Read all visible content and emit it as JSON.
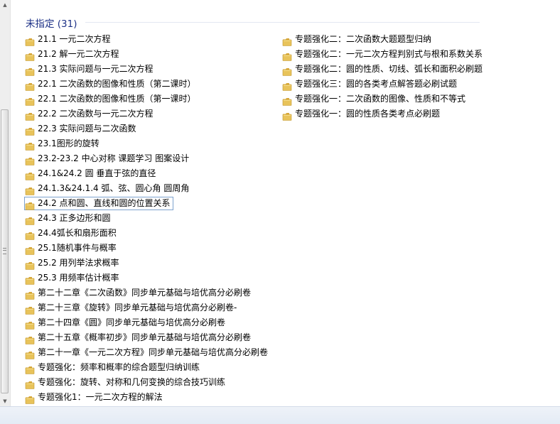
{
  "group": {
    "title": "未指定 (31)"
  },
  "colors": {
    "group_title": "#1e3287",
    "folder_body": "#e8c35a",
    "folder_tab": "#d9a93a",
    "selection_border": "#7da2ce"
  },
  "icons": {
    "folder": "folder-icon"
  },
  "items_left": [
    {
      "label": "21.1 一元二次方程"
    },
    {
      "label": "21.2 解一元二次方程"
    },
    {
      "label": "21.3 实际问题与一元二次方程"
    },
    {
      "label": "22.1 二次函数的图像和性质（第二课时）"
    },
    {
      "label": "22.1 二次函数的图像和性质（第一课时）"
    },
    {
      "label": "22.2 二次函数与一元二次方程"
    },
    {
      "label": "22.3 实际问题与二次函数"
    },
    {
      "label": "23.1图形的旋转"
    },
    {
      "label": "23.2-23.2 中心对称 课题学习 图案设计"
    },
    {
      "label": "24.1&24.2 圆 垂直于弦的直径"
    },
    {
      "label": "24.1.3&24.1.4 弧、弦、圆心角 圆周角"
    },
    {
      "label": "24.2 点和圆、直线和圆的位置关系",
      "selected": true
    },
    {
      "label": "24.3 正多边形和圆"
    },
    {
      "label": "24.4弧长和扇形面积"
    },
    {
      "label": "25.1随机事件与概率"
    },
    {
      "label": "25.2 用列举法求概率"
    },
    {
      "label": "25.3 用频率估计概率"
    },
    {
      "label": "第二十二章《二次函数》同步单元基础与培优高分必刷卷"
    },
    {
      "label": "第二十三章《旋转》同步单元基础与培优高分必刷卷-"
    },
    {
      "label": "第二十四章《圆》同步单元基础与培优高分必刷卷"
    },
    {
      "label": "第二十五章《概率初步》同步单元基础与培优高分必刷卷"
    },
    {
      "label": "第二十一章《一元二次方程》同步单元基础与培优高分必刷卷"
    },
    {
      "label": "专题强化：频率和概率的综合题型归纳训练"
    },
    {
      "label": "专题强化：旋转、对称和几何变换的综合技巧训练"
    },
    {
      "label": "专题强化1：一元二次方程的解法"
    }
  ],
  "items_right": [
    {
      "label": "专题强化二：二次函数大题题型归纳"
    },
    {
      "label": "专题强化二：一元二次方程判别式与根和系数关系"
    },
    {
      "label": "专题强化二：圆的性质、切线、弧长和面积必刷题"
    },
    {
      "label": "专题强化三：圆的各类考点解答题必刷试题"
    },
    {
      "label": "专题强化一：二次函数的图像、性质和不等式"
    },
    {
      "label": "专题强化一：圆的性质各类考点必刷题"
    }
  ]
}
